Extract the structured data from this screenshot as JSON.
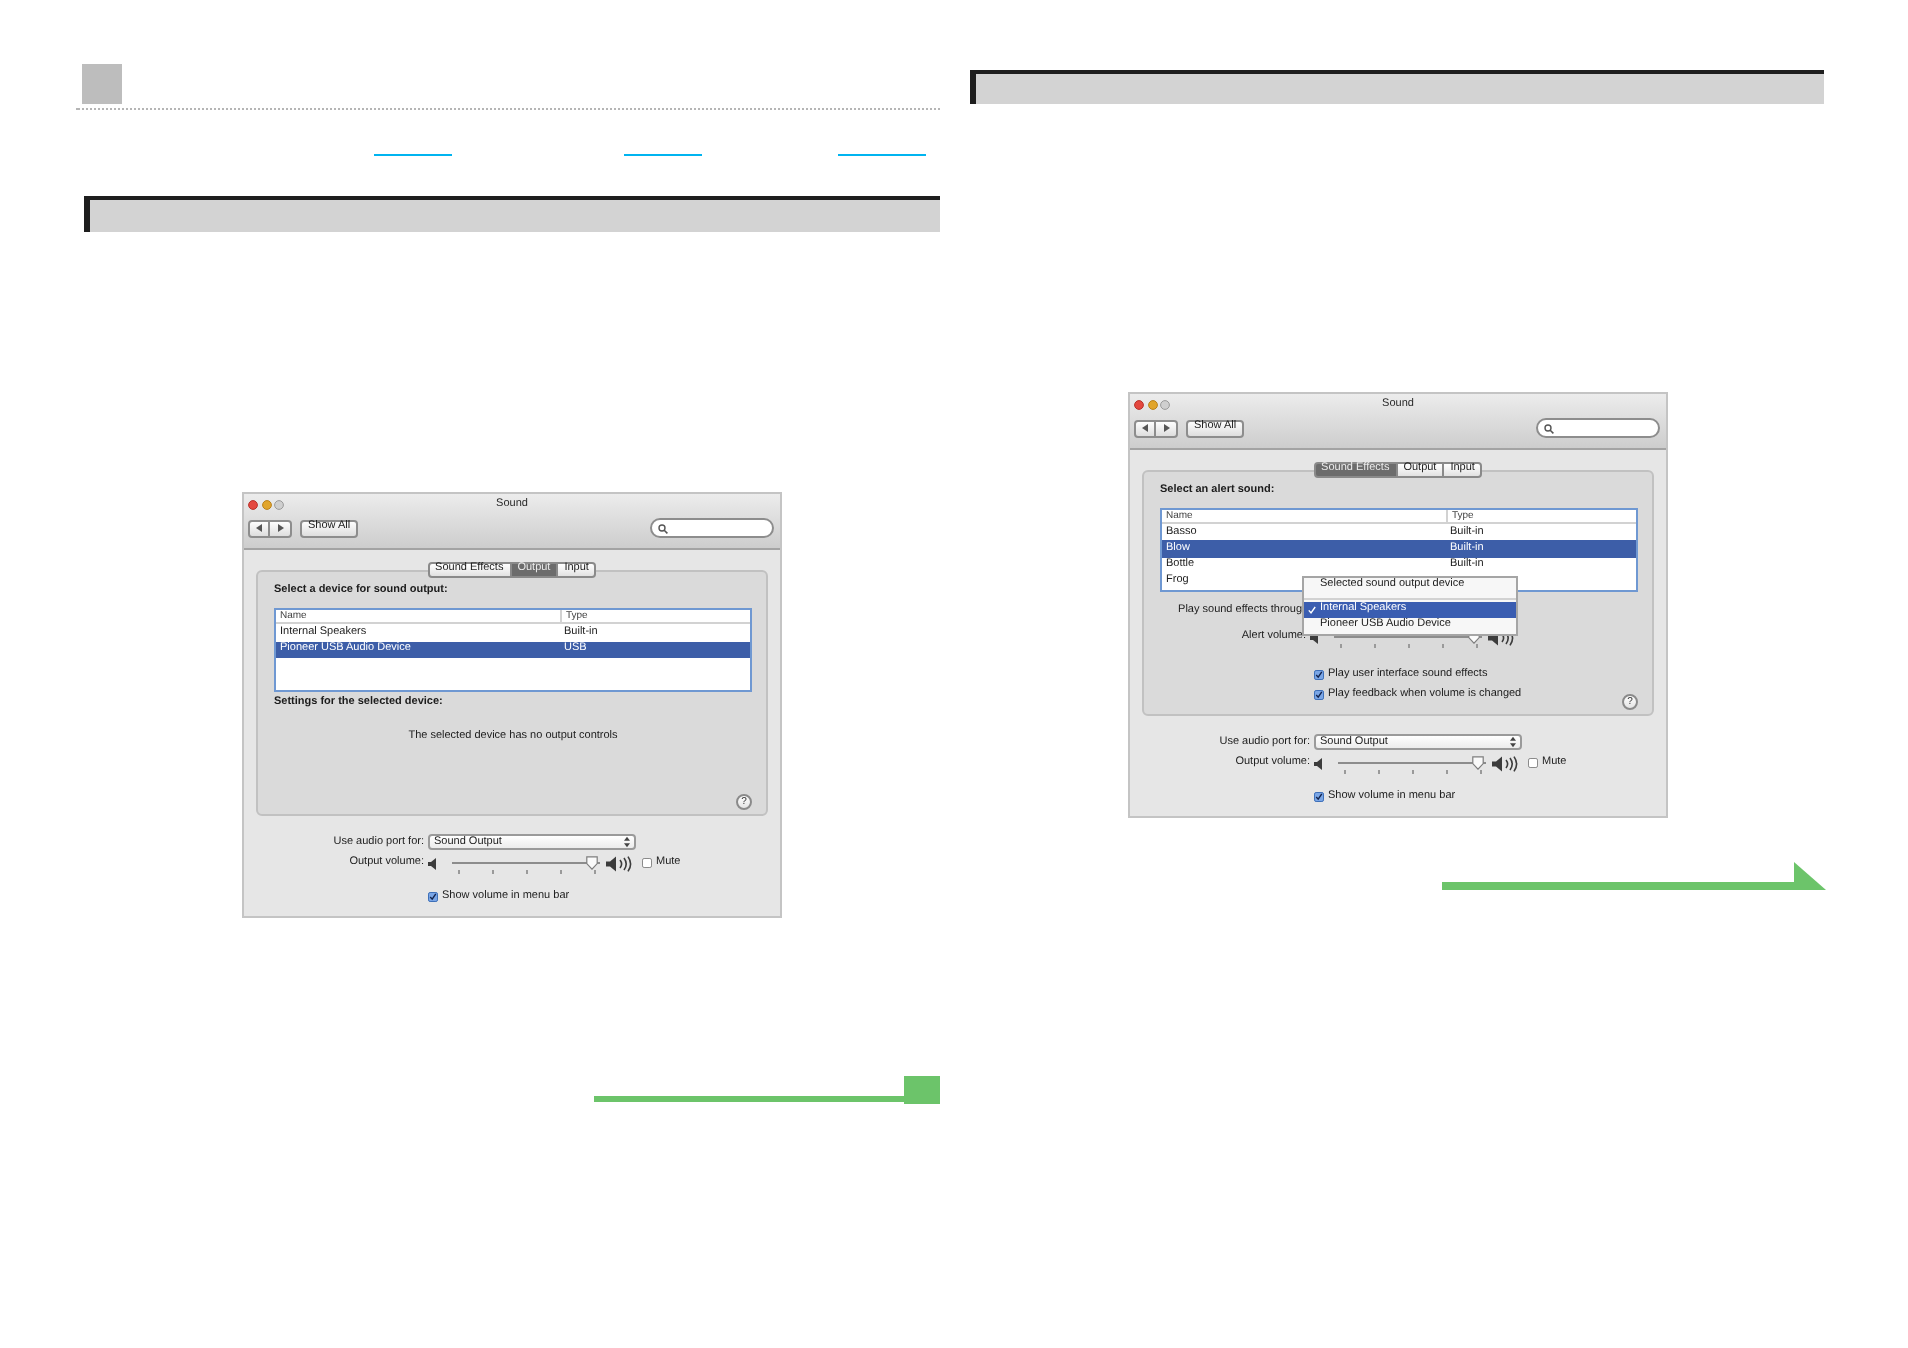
{
  "windows": [
    {
      "title": "Sound",
      "show_all": "Show All",
      "tabs": [
        {
          "label": "Sound Effects",
          "selected": false
        },
        {
          "label": "Output",
          "selected": true
        },
        {
          "label": "Input",
          "selected": false
        }
      ],
      "panel": {
        "kind": "output",
        "list_label": "Select a device for sound output:",
        "columns": [
          "Name",
          "Type"
        ],
        "rows": [
          {
            "name": "Internal Speakers",
            "type": "Built-in",
            "selected": false
          },
          {
            "name": "Pioneer USB Audio Device",
            "type": "USB",
            "selected": true
          }
        ],
        "settings_label": "Settings for the selected device:",
        "message": "The selected device has no output controls",
        "help": "?"
      },
      "audio_port": {
        "label": "Use audio port for:",
        "value": "Sound Output"
      },
      "output_volume": {
        "label": "Output volume:",
        "level": 0.95
      },
      "mute": {
        "label": "Mute",
        "checked": false
      },
      "show_volume": {
        "label": "Show volume in menu bar",
        "checked": true
      }
    },
    {
      "title": "Sound",
      "show_all": "Show All",
      "tabs": [
        {
          "label": "Sound Effects",
          "selected": true
        },
        {
          "label": "Output",
          "selected": false
        },
        {
          "label": "Input",
          "selected": false
        }
      ],
      "panel": {
        "kind": "sound_effects",
        "list_label": "Select an alert sound:",
        "columns": [
          "Name",
          "Type"
        ],
        "rows": [
          {
            "name": "Basso",
            "type": "Built-in",
            "selected": false
          },
          {
            "name": "Blow",
            "type": "Built-in",
            "selected": true
          },
          {
            "name": "Bottle",
            "type": "Built-in",
            "selected": false
          },
          {
            "name": "Frog",
            "selected": false
          }
        ],
        "effects_output": {
          "label": "Play sound effects throug"
        },
        "popup_menu": [
          {
            "kind": "item",
            "label": "Selected sound output device",
            "checked": false,
            "selected": false
          },
          {
            "kind": "separator"
          },
          {
            "kind": "item",
            "label": "Internal Speakers",
            "checked": true,
            "selected": true
          },
          {
            "kind": "item",
            "label": "Pioneer USB Audio Device",
            "checked": false,
            "selected": false
          }
        ],
        "alert_volume": {
          "label": "Alert volume:",
          "level": 0.95
        },
        "options": [
          {
            "label": "Play user interface sound effects",
            "checked": true
          },
          {
            "label": "Play feedback when volume is changed",
            "checked": true
          }
        ],
        "help": "?"
      },
      "audio_port": {
        "label": "Use audio port for:",
        "value": "Sound Output"
      },
      "output_volume": {
        "label": "Output volume:",
        "level": 0.95
      },
      "mute": {
        "label": "Mute",
        "checked": false
      },
      "show_volume": {
        "label": "Show volume in menu bar",
        "checked": true
      }
    }
  ]
}
